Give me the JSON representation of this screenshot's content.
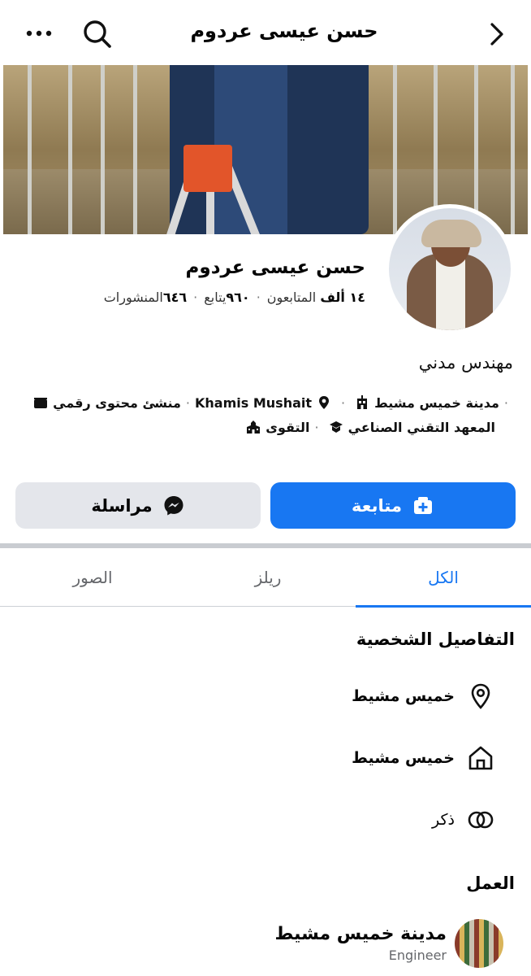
{
  "header": {
    "title": "حسن عيسى عردوم"
  },
  "profile": {
    "name": "حسن عيسى عردوم",
    "followers_count": "١٤ ألف",
    "followers_label": "المتابعون",
    "following_count": "٩٦٠",
    "following_label": "يتابع",
    "posts_count": "٦٤٦",
    "posts_label": "المنشورات",
    "bio": "مهندس مدني"
  },
  "details": {
    "row1": [
      "مدينة خميس مشيط",
      "Khamis Mushait",
      "منشئ محتوى رقمي"
    ],
    "row2": [
      "المعهد التقني الصناعي",
      "التقوى"
    ]
  },
  "actions": {
    "follow_label": "متابعة",
    "message_label": "مراسلة"
  },
  "tabs": [
    {
      "label": "الكل",
      "active": true
    },
    {
      "label": "ريلز",
      "active": false
    },
    {
      "label": "الصور",
      "active": false
    }
  ],
  "personal_details": {
    "title": "التفاصيل الشخصية",
    "location": "خميس مشيط",
    "hometown": "خميس مشيط",
    "gender": "ذكر"
  },
  "work": {
    "title": "العمل",
    "place": "مدينة خميس مشيط",
    "role": "Engineer"
  },
  "colors": {
    "accent": "#1877f2",
    "secondary_button": "#e4e6eb",
    "muted_text": "#65676b"
  }
}
